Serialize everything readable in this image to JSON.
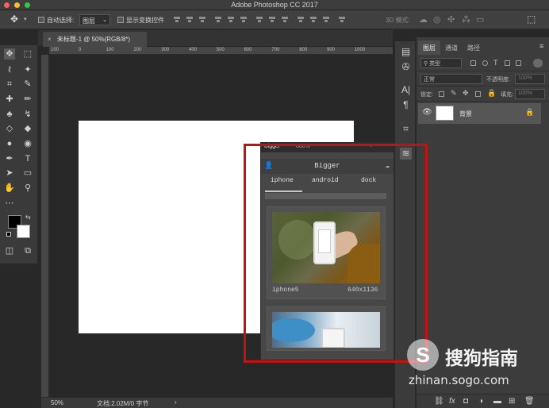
{
  "window": {
    "title": "Adobe Photoshop CC 2017"
  },
  "optionsbar": {
    "auto_select_label": "自动选择:",
    "auto_select_value": "图层",
    "show_transform_label": "显示变换控件",
    "mode_3d_label": "3D 模式:"
  },
  "document": {
    "tab_title": "未标题-1 @ 50%(RGB/8*)"
  },
  "ruler": {
    "ticks": [
      "100",
      "0",
      "100",
      "200",
      "300",
      "400",
      "500",
      "600",
      "700",
      "800",
      "900",
      "1000"
    ]
  },
  "status": {
    "zoom": "50%",
    "doc_info": "文档:2.02M/0 字节",
    "arrow": "›"
  },
  "layers_panel": {
    "tabs": [
      "图层",
      "通道",
      "路径"
    ],
    "kind_filter": "类型",
    "blend_mode": "正常",
    "opacity_label": "不透明度:",
    "opacity_value": "100%",
    "lock_label": "锁定:",
    "fill_label": "填充:",
    "fill_value": "100%",
    "layer_name": "背景"
  },
  "bigger_panel": {
    "header": "Bigger",
    "header_pct": "000%",
    "title": "Bigger",
    "tabs": [
      "iphone",
      "android",
      "dock"
    ],
    "card_name": "iphone5",
    "card_size": "640x1136"
  },
  "watermark": {
    "logo": "S",
    "text": "搜狗指南",
    "url": "zhinan.sogo.com"
  },
  "colors": {
    "highlight_box": "#c41212",
    "canvas_bg": "#282828",
    "panel_bg": "#3c3c3c"
  }
}
